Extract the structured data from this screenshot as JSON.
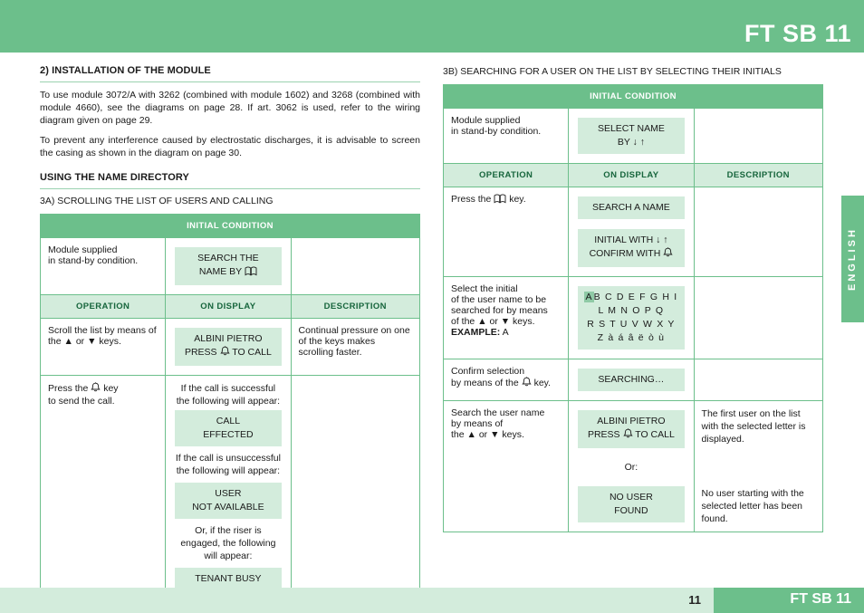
{
  "header": {
    "title": "FT SB 11"
  },
  "footer": {
    "page": "11",
    "title": "FT SB 11"
  },
  "side_tab": {
    "label": "ENGLISH"
  },
  "left": {
    "section_title": "2) INSTALLATION OF THE MODULE",
    "paragraphs": [
      "To use module 3072/A with 3262 (combined with module 1602) and 3268 (combined with module 4660), see the diagrams on page 28. If art. 3062 is used, refer to the wiring diagram given on page 29.",
      "To prevent any interference caused by electrostatic discharges, it is advisable to screen the casing as shown in the diagram on page 30."
    ],
    "subsection_title": "USING THE NAME DIRECTORY",
    "caption": "3A) SCROLLING THE LIST OF USERS AND CALLING",
    "table": {
      "initial_condition_band": "INITIAL CONDITION",
      "initial_condition": {
        "operation_line1": "Module supplied",
        "operation_line2": "in stand-by condition.",
        "display_line1": "SEARCH THE",
        "display_line2": "NAME BY"
      },
      "headers": [
        "OPERATION",
        "ON DISPLAY",
        "DESCRIPTION"
      ],
      "rows": [
        {
          "operation": "Scroll the list by means of the ▲ or ▼ keys.",
          "display_line1": "ALBINI PIETRO",
          "display_line2_pre": "PRESS",
          "display_line2_post": "TO CALL",
          "description": "Continual pressure on one of the keys makes scrolling faster."
        },
        {
          "operation_pre": "Press the",
          "operation_post": "key",
          "operation_line2": "to send the call.",
          "text1": "If the call is successful the following will appear:",
          "lcd1_line1": "CALL",
          "lcd1_line2": "EFFECTED",
          "text2": "If the call is unsuccessful the following will appear:",
          "lcd2_line1": "USER",
          "lcd2_line2": "NOT AVAILABLE",
          "text3": "Or, if the riser is engaged, the following will appear:",
          "lcd3_line1": "TENANT BUSY",
          "description": ""
        }
      ]
    }
  },
  "right": {
    "caption": "3B) SEARCHING FOR A USER ON THE LIST BY SELECTING THEIR INITIALS",
    "table": {
      "initial_condition_band": "INITIAL CONDITION",
      "initial_condition": {
        "operation_line1": "Module supplied",
        "operation_line2": "in stand-by condition.",
        "display_line1": "SELECT NAME",
        "display_line2": "BY  ↓   ↑"
      },
      "headers": [
        "OPERATION",
        "ON DISPLAY",
        "DESCRIPTION"
      ],
      "rows": [
        {
          "operation_pre": "Press the",
          "operation_post": "key.",
          "lcd1": "SEARCH A NAME",
          "lcd2_line1": "INITIAL WITH ↓  ↑",
          "lcd2_line2_pre": "CONFIRM WITH",
          "description": ""
        },
        {
          "operation_line1": "Select the initial",
          "operation_line2": "of the user name to be",
          "operation_line3": "searched for by means",
          "operation_line4": "of the ▲ or ▼ keys.",
          "example_label": "EXAMPLE:",
          "example_value": "A",
          "alpha_line1_hl": "A",
          "alpha_line1": "B C D E F G H I L M N O P Q",
          "alpha_line2": "R S T U V W X Y Z à á â ë ò ù",
          "description": ""
        },
        {
          "operation_line1": "Confirm selection",
          "operation_line2_pre": "by means of the",
          "operation_line2_post": "key.",
          "lcd1": "SEARCHING…",
          "description": ""
        },
        {
          "operation_line1": "Search the user name",
          "operation_line2": "by means of",
          "operation_line3": "the ▲ or ▼ keys.",
          "lcd1_line1": "ALBINI PIETRO",
          "lcd1_line2_pre": "PRESS",
          "lcd1_line2_post": "TO CALL",
          "or_label": "Or:",
          "lcd2_line1": "NO USER",
          "lcd2_line2": "FOUND",
          "description1": "The first user on the list with the selected letter is displayed.",
          "description2": "No user starting with the selected letter has been found."
        }
      ]
    }
  },
  "icons": {
    "bell": "bell-icon",
    "book": "book-icon"
  }
}
